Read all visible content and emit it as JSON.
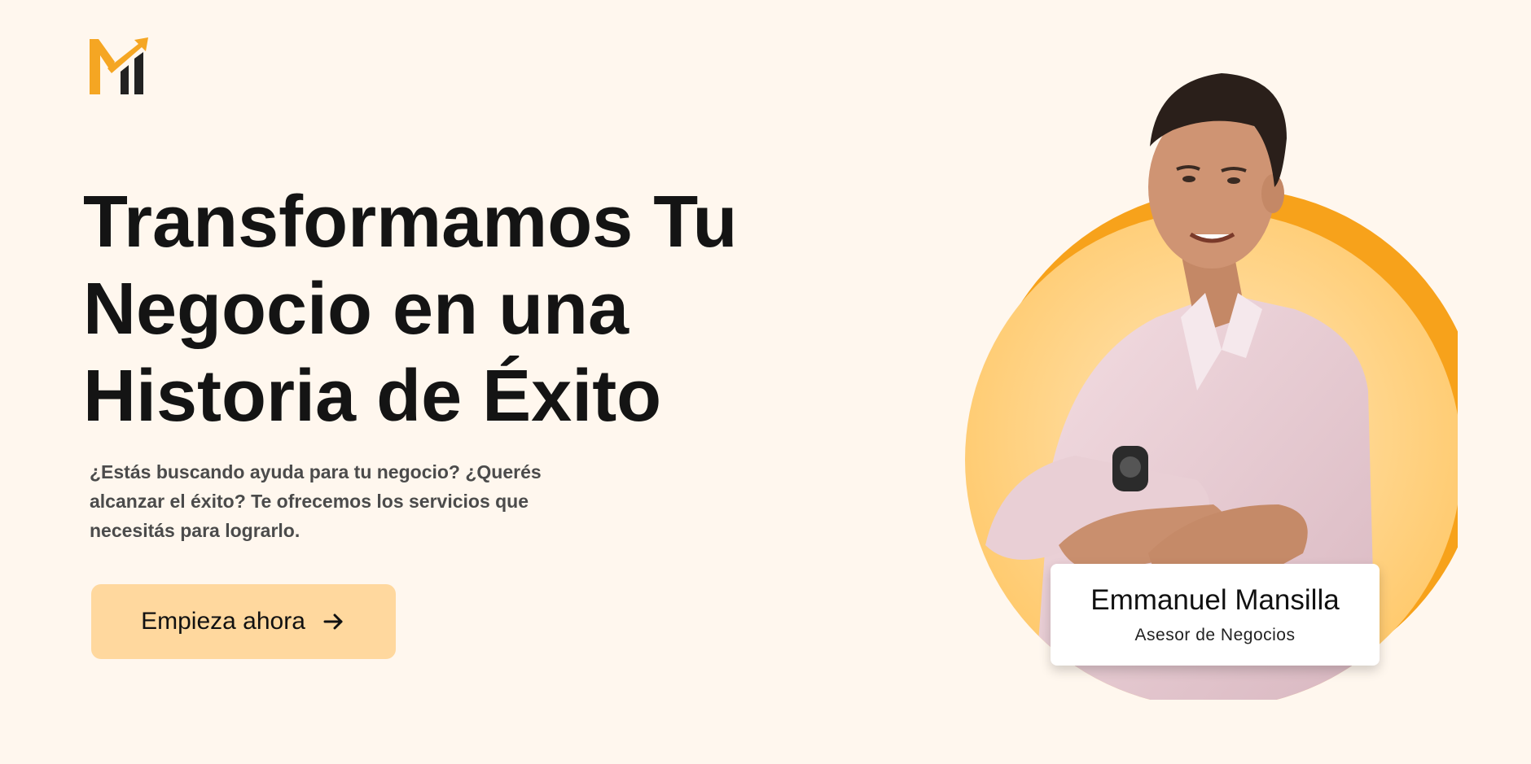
{
  "brand": {
    "logo_icon": "m-growth-arrow-logo",
    "accent": "#f5a623",
    "dark": "#222222"
  },
  "hero": {
    "headline_lines": [
      "Transformamos Tu",
      "Negocio en una",
      "Historia de Éxito"
    ],
    "subtext": "¿Estás buscando ayuda para tu negocio? ¿Querés alcanzar el éxito? Te ofrecemos los servicios que necesitás para lograrlo.",
    "cta_label": "Empieza ahora",
    "cta_icon": "arrow-right-icon",
    "cta_color": "#ffd89e"
  },
  "profile": {
    "name": "Emmanuel Mansilla",
    "role": "Asesor de Negocios",
    "circle_color": "#ffd38a",
    "ring_color": "#f7a21b"
  },
  "colors": {
    "background": "#fff7ee",
    "headline": "#141414",
    "subtext": "#4b4b4b"
  }
}
